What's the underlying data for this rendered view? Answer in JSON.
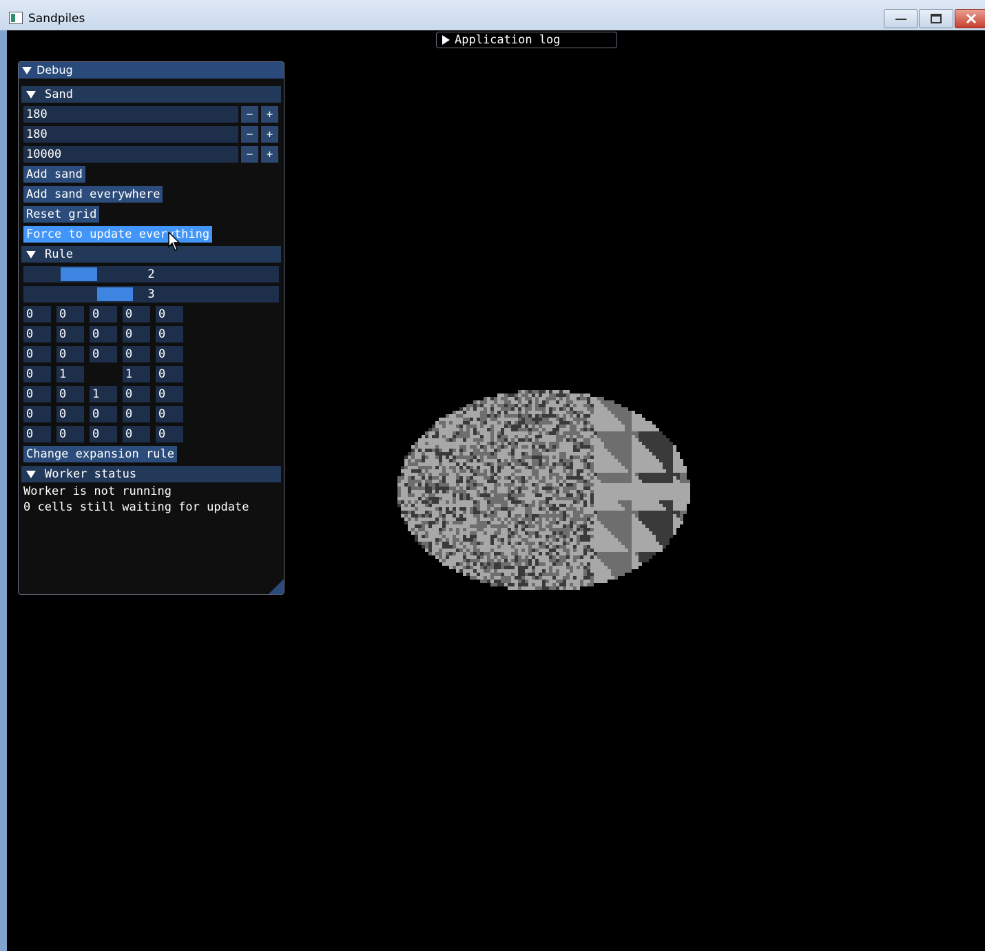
{
  "window": {
    "title": "Sandpiles"
  },
  "log_bar": {
    "label": "Application log"
  },
  "debug": {
    "title": "Debug",
    "sand": {
      "header": "Sand",
      "inputs": [
        {
          "value": "180",
          "minus": "−",
          "plus": "+"
        },
        {
          "value": "180",
          "minus": "−",
          "plus": "+"
        },
        {
          "value": "10000",
          "minus": "−",
          "plus": "+"
        }
      ],
      "add_sand": "Add sand",
      "add_sand_everywhere": "Add sand everywhere",
      "reset_grid": "Reset grid",
      "force_update": "Force to update everything"
    },
    "rule": {
      "header": "Rule",
      "slider1": {
        "value": "2"
      },
      "slider2": {
        "value": "3"
      },
      "grid": [
        [
          "0",
          "0",
          "0",
          "0",
          "0"
        ],
        [
          "0",
          "0",
          "0",
          "0",
          "0"
        ],
        [
          "0",
          "0",
          "0",
          "0",
          "0"
        ],
        [
          "0",
          "1",
          "",
          "1",
          "0"
        ],
        [
          "0",
          "0",
          "1",
          "0",
          "0"
        ],
        [
          "0",
          "0",
          "0",
          "0",
          "0"
        ],
        [
          "0",
          "0",
          "0",
          "0",
          "0"
        ]
      ],
      "change_rule": "Change expansion rule"
    },
    "worker": {
      "header": "Worker status",
      "line1": "Worker is not running",
      "line2": "0 cells still waiting for update"
    }
  },
  "colors": {
    "panel_title": "#294a7a",
    "header": "#23395a",
    "field": "#1d2f4b",
    "button": "#2c4d7b",
    "button_active": "#4296fa",
    "slider_grab": "#3d85e0",
    "pile_light": "#a8a8a8",
    "pile_mid": "#6e6e6e",
    "pile_dark": "#3a3a3a"
  }
}
